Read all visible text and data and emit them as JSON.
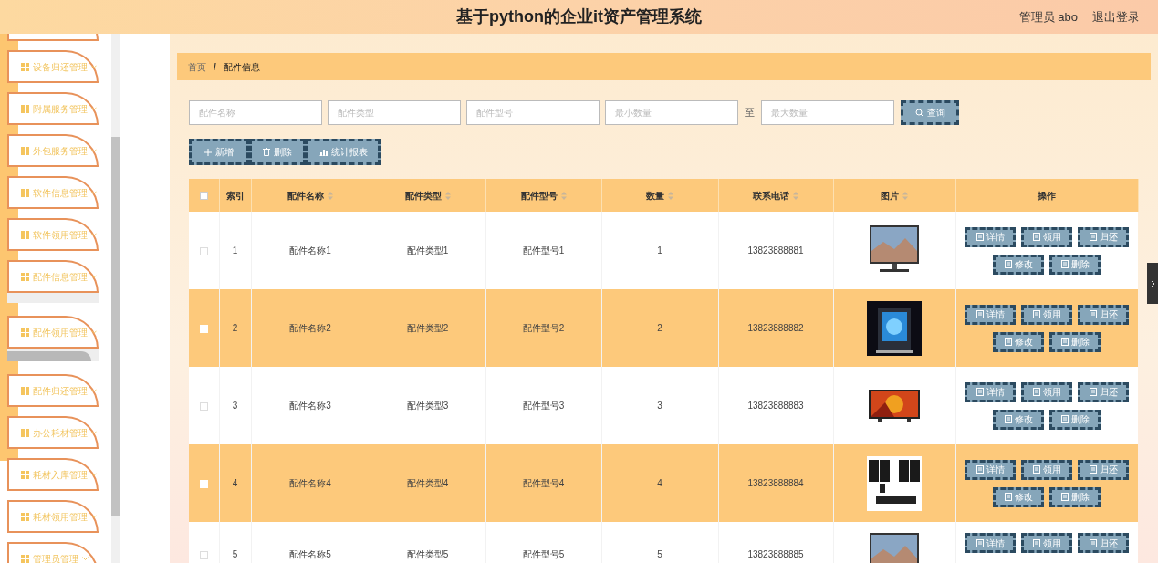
{
  "header": {
    "title": "基于python的企业it资产管理系统",
    "user": "管理员 abo",
    "logout": "退出登录"
  },
  "sidebar": {
    "items": [
      {
        "kind": "cut"
      },
      {
        "label": "设备归还管理",
        "kind": "menu"
      },
      {
        "label": "附属服务管理",
        "kind": "menu"
      },
      {
        "label": "外包服务管理",
        "kind": "menu"
      },
      {
        "label": "软件信息管理",
        "kind": "menu"
      },
      {
        "label": "软件领用管理",
        "kind": "menu"
      },
      {
        "label": "配件信息管理",
        "kind": "menu"
      },
      {
        "kind": "submenu"
      },
      {
        "label": "配件领用管理",
        "kind": "menu"
      },
      {
        "kind": "hover"
      },
      {
        "label": "配件归还管理",
        "kind": "menu"
      },
      {
        "label": "办公耗材管理",
        "kind": "menu"
      },
      {
        "label": "耗材入库管理",
        "kind": "menu"
      },
      {
        "label": "耗材领用管理",
        "kind": "menu"
      },
      {
        "label": "管理员管理",
        "kind": "menu"
      }
    ]
  },
  "breadcrumb": {
    "items": [
      "首页",
      "配件信息"
    ],
    "separator": "/"
  },
  "search": {
    "fields": [
      {
        "placeholder": "配件名称"
      },
      {
        "placeholder": "配件类型"
      },
      {
        "placeholder": "配件型号"
      },
      {
        "placeholder": "最小数量"
      },
      {
        "placeholder": "最大数量"
      }
    ],
    "range_separator": "至",
    "button": "查询"
  },
  "toolbar": [
    {
      "label": "新增",
      "kind": "add"
    },
    {
      "label": "删除",
      "kind": "delete"
    },
    {
      "label": "统计报表",
      "kind": "chart"
    }
  ],
  "table": {
    "columns": [
      {
        "kind": "check",
        "checked": false
      },
      {
        "label": "索引",
        "sortable": false
      },
      {
        "label": "配件名称",
        "sortable": true
      },
      {
        "label": "配件类型",
        "sortable": true
      },
      {
        "label": "配件型号",
        "sortable": true
      },
      {
        "label": "数量",
        "sortable": true
      },
      {
        "label": "联系电话",
        "sortable": true
      },
      {
        "label": "图片",
        "sortable": true
      },
      {
        "label": "操作",
        "sortable": false
      }
    ],
    "rows": [
      {
        "checked": false,
        "index": "1",
        "name": "配件名称1",
        "type": "配件类型1",
        "model": "配件型号1",
        "qty": "1",
        "phone": "13823888881",
        "actions": [
          "详情",
          "领用",
          "归还",
          "修改",
          "删除"
        ]
      },
      {
        "checked": false,
        "index": "2",
        "name": "配件名称2",
        "type": "配件类型2",
        "model": "配件型号2",
        "qty": "2",
        "phone": "13823888882",
        "actions": [
          "详情",
          "领用",
          "归还",
          "修改",
          "删除"
        ]
      },
      {
        "checked": false,
        "index": "3",
        "name": "配件名称3",
        "type": "配件类型3",
        "model": "配件型号3",
        "qty": "3",
        "phone": "13823888883",
        "actions": [
          "详情",
          "领用",
          "归还",
          "修改",
          "删除"
        ]
      },
      {
        "checked": false,
        "index": "4",
        "name": "配件名称4",
        "type": "配件类型4",
        "model": "配件型号4",
        "qty": "4",
        "phone": "13823888884",
        "actions": [
          "详情",
          "领用",
          "归还",
          "修改",
          "删除"
        ]
      },
      {
        "checked": false,
        "index": "5",
        "name": "配件名称5",
        "type": "配件类型5",
        "model": "配件型号5",
        "qty": "5",
        "phone": "13823888885",
        "actions": [
          "详情",
          "领用",
          "归还"
        ]
      }
    ]
  }
}
